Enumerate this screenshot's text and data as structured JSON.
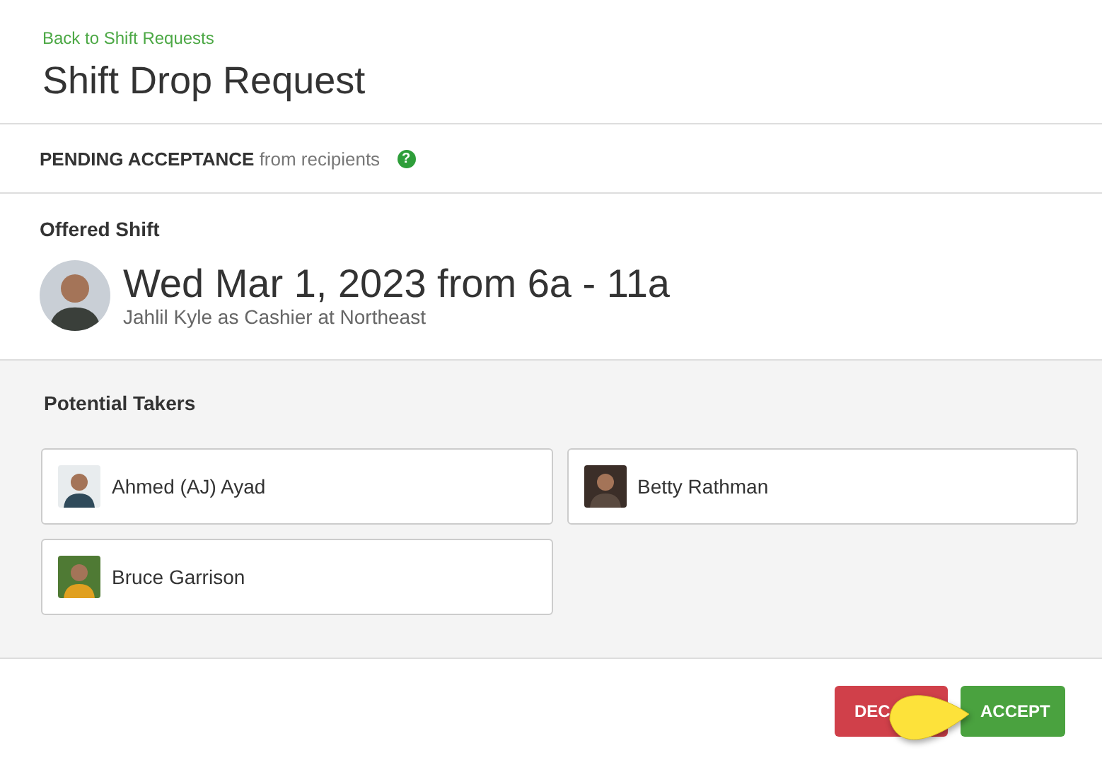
{
  "back_link": "Back to Shift Requests",
  "title": "Shift Drop Request",
  "status": {
    "label": "PENDING ACCEPTANCE",
    "detail": "from recipients",
    "help": "?"
  },
  "offered_shift": {
    "heading": "Offered Shift",
    "when": "Wed Mar 1, 2023 from 6a - 11a",
    "detail": "Jahlil Kyle as Cashier at Northeast"
  },
  "potential_takers": {
    "heading": "Potential Takers",
    "people": [
      {
        "name": "Ahmed (AJ) Ayad"
      },
      {
        "name": "Betty Rathman"
      },
      {
        "name": "Bruce Garrison"
      }
    ]
  },
  "actions": [
    {
      "kind": "decline",
      "label": "DEC"
    },
    {
      "kind": "accept",
      "label": "ACCEPT"
    }
  ]
}
